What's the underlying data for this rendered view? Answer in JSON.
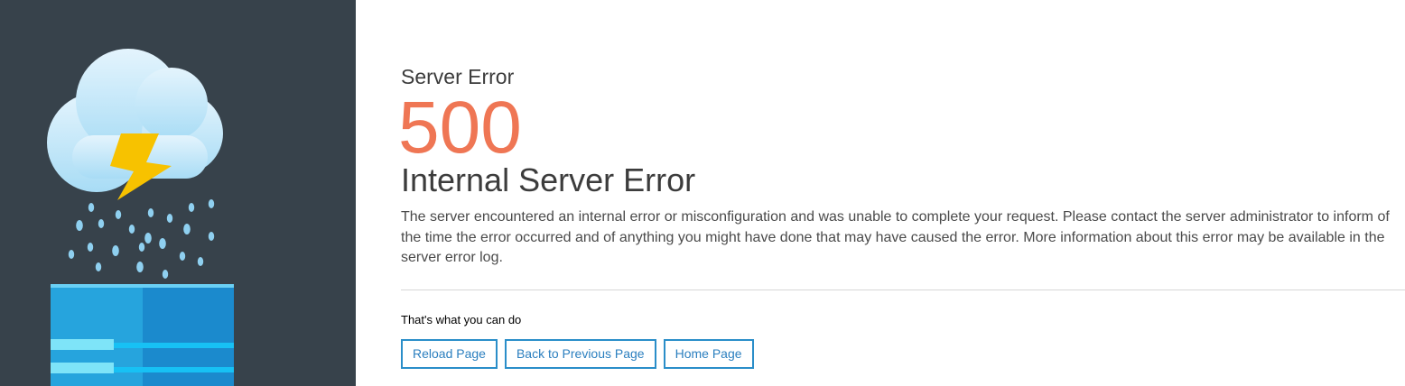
{
  "error": {
    "subtitle": "Server Error",
    "code": "500",
    "title": "Internal Server Error",
    "description": "The server encountered an internal error or misconfiguration and was unable to complete your request. Please contact the server administrator to inform of the time the error occurred and of anything you might have done that may have caused the error. More information about this error may be available in the server error log."
  },
  "actions": {
    "heading": "That's what you can do",
    "reload_label": "Reload Page",
    "back_label": "Back to Previous Page",
    "home_label": "Home Page"
  },
  "illustration": {
    "icons": [
      "storm-cloud-icon",
      "lightning-bolt-icon",
      "rain-drops-icon",
      "server-block-icon"
    ]
  },
  "colors": {
    "sidebar_bg": "#37424b",
    "error_code": "#ef7654",
    "button_border": "#2a8ec9",
    "text": "#3c3c3c"
  }
}
